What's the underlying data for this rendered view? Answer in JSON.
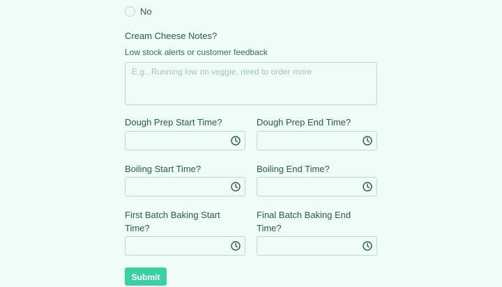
{
  "radio": {
    "option_no": "No"
  },
  "cream_cheese": {
    "label": "Cream Cheese Notes?",
    "help": "Low stock alerts or customer feedback",
    "placeholder": "E.g., Running low on veggie, need to order more"
  },
  "fields": {
    "dough_prep_start": "Dough Prep Start Time?",
    "dough_prep_end": "Dough Prep End Time?",
    "boiling_start": "Boiling Start Time?",
    "boiling_end": "Boiling End Time?",
    "first_batch_start_line1": "First Batch Baking Start",
    "first_batch_start_line2": "Time?",
    "final_batch_end_line1": "Final Batch Baking End",
    "final_batch_end_line2": "Time?"
  },
  "submit_label": "Submit",
  "icons": {
    "time": "clock-icon"
  },
  "colors": {
    "background": "#effcf6",
    "accent": "#3dcfa4",
    "text": "#2a5a4f"
  }
}
